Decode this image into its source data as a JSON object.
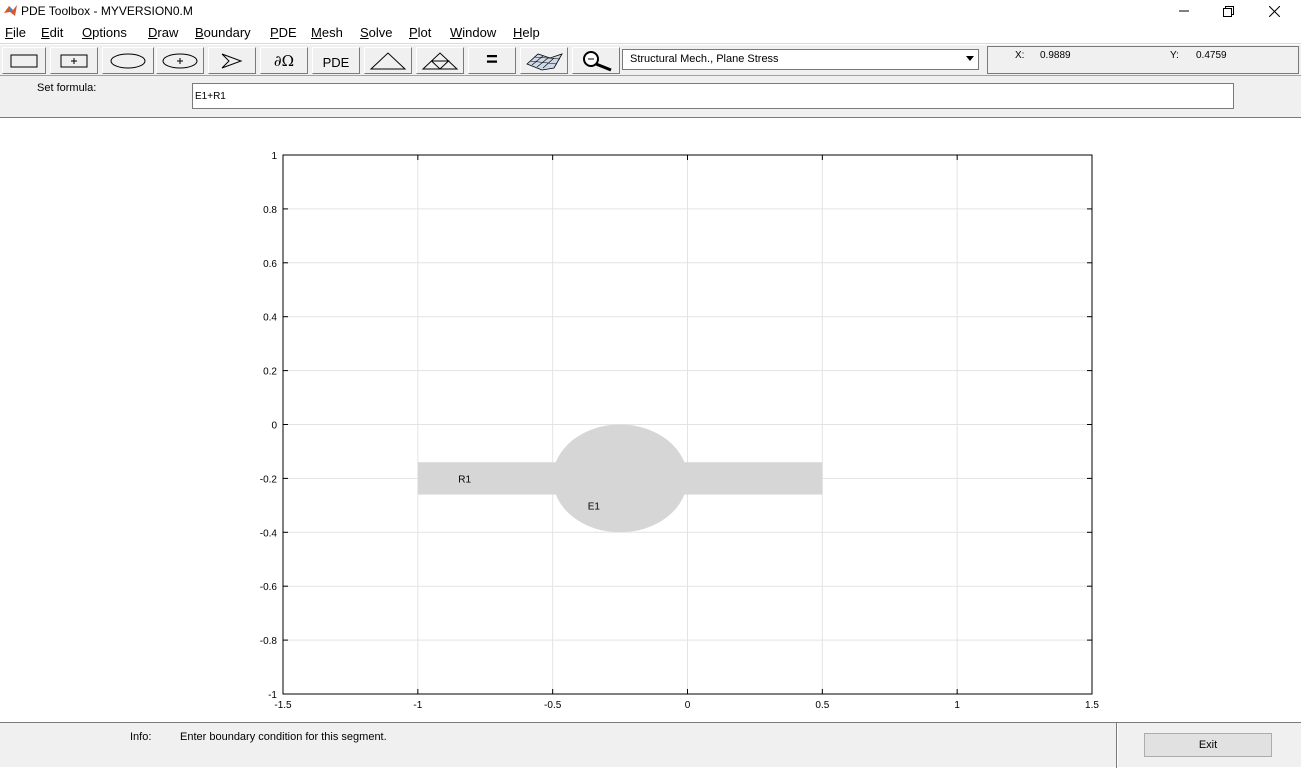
{
  "window": {
    "title": "PDE Toolbox - MYVERSION0.M",
    "minimize_icon": "minimize-icon",
    "restore_icon": "restore-icon",
    "close_icon": "close-icon"
  },
  "menu": [
    {
      "accel": "F",
      "rest": "ile"
    },
    {
      "accel": "E",
      "rest": "dit"
    },
    {
      "accel": "O",
      "rest": "ptions"
    },
    {
      "accel": "D",
      "rest": "raw"
    },
    {
      "accel": "B",
      "rest": "oundary"
    },
    {
      "accel": "P",
      "rest": "DE"
    },
    {
      "accel": "M",
      "rest": "esh"
    },
    {
      "accel": "S",
      "rest": "olve"
    },
    {
      "accel": "P",
      "rest": "lot"
    },
    {
      "accel": "W",
      "rest": "indow"
    },
    {
      "accel": "H",
      "rest": "elp"
    }
  ],
  "toolbar": {
    "boundary_label": "∂Ω",
    "pde_label": "PDE",
    "equals_label": "="
  },
  "app_mode": {
    "selected": "Structural Mech., Plane Stress"
  },
  "coords": {
    "x_label": "X:",
    "x_value": "0.9889",
    "y_label": "Y:",
    "y_value": "0.4759"
  },
  "formula": {
    "label": "Set formula:",
    "value": "E1+R1"
  },
  "chart_data": {
    "type": "scatter",
    "xlim": [
      -1.5,
      1.5
    ],
    "ylim": [
      -1,
      1
    ],
    "grid": true,
    "x_ticks": [
      -1.5,
      -1,
      -0.5,
      0,
      0.5,
      1,
      1.5
    ],
    "x_tick_labels": [
      "-1.5",
      "-1",
      "-0.5",
      "0",
      "0.5",
      "1",
      "1.5"
    ],
    "y_ticks": [
      1,
      0.8,
      0.6,
      0.4,
      0.2,
      0,
      -0.2,
      -0.4,
      -0.6,
      -0.8,
      -1
    ],
    "y_tick_labels": [
      "1",
      "0.8",
      "0.6",
      "0.4",
      "0.2",
      "0",
      "-0.2",
      "-0.4",
      "-0.6",
      "-0.8",
      "-1"
    ],
    "shapes": [
      {
        "label": "R1",
        "kind": "rectangle",
        "x_min": -1.0,
        "x_max": 0.5,
        "y_min": -0.26,
        "y_max": -0.14,
        "label_at": [
          -0.85,
          -0.2
        ]
      },
      {
        "label": "E1",
        "kind": "ellipse",
        "cx": -0.25,
        "cy": -0.2,
        "rx": 0.25,
        "ry": 0.2,
        "label_at": [
          -0.37,
          -0.3
        ]
      }
    ],
    "fill_color": "#d6d6d6"
  },
  "status": {
    "info_label": "Info:",
    "info_text": "Enter boundary condition for this segment.",
    "exit_label": "Exit"
  }
}
